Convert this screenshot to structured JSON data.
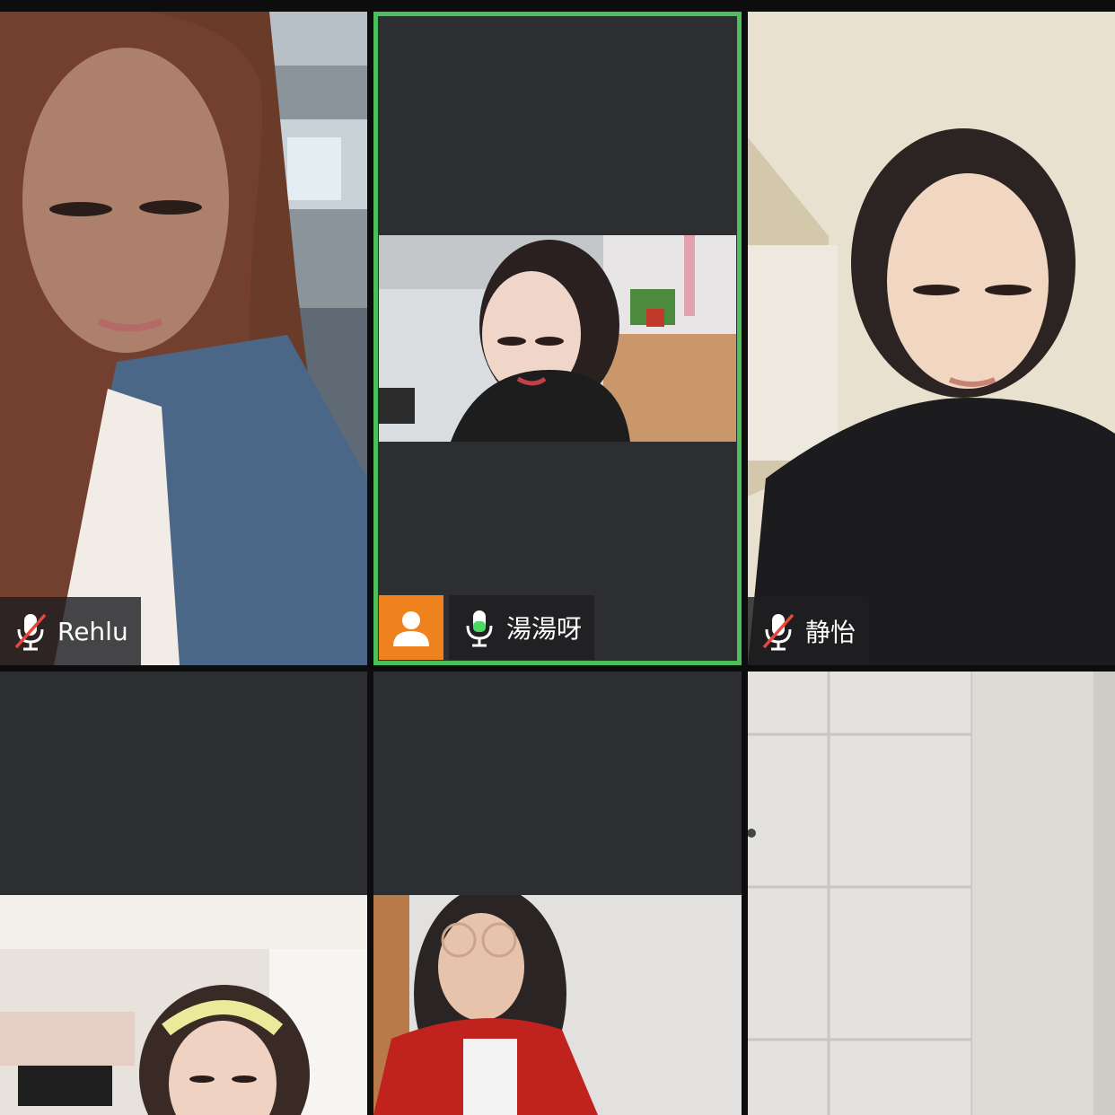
{
  "participants": [
    {
      "name": "Rehlu",
      "mic": "muted"
    },
    {
      "name": "湯湯呀",
      "mic": "active",
      "speaking": true
    },
    {
      "name": "静怡",
      "mic": "muted"
    },
    {
      "name": "",
      "mic": "unknown"
    },
    {
      "name": "",
      "mic": "unknown"
    },
    {
      "name": "",
      "mic": "unknown"
    }
  ],
  "colors": {
    "active_border": "#4cbf5a",
    "avatar_bg": "#f0821e",
    "tile_bg": "#2d2e31",
    "muted_slash": "#e8473b"
  },
  "icons": {
    "muted": "mic-muted-icon",
    "active": "mic-active-icon",
    "avatar": "user-avatar-icon"
  }
}
